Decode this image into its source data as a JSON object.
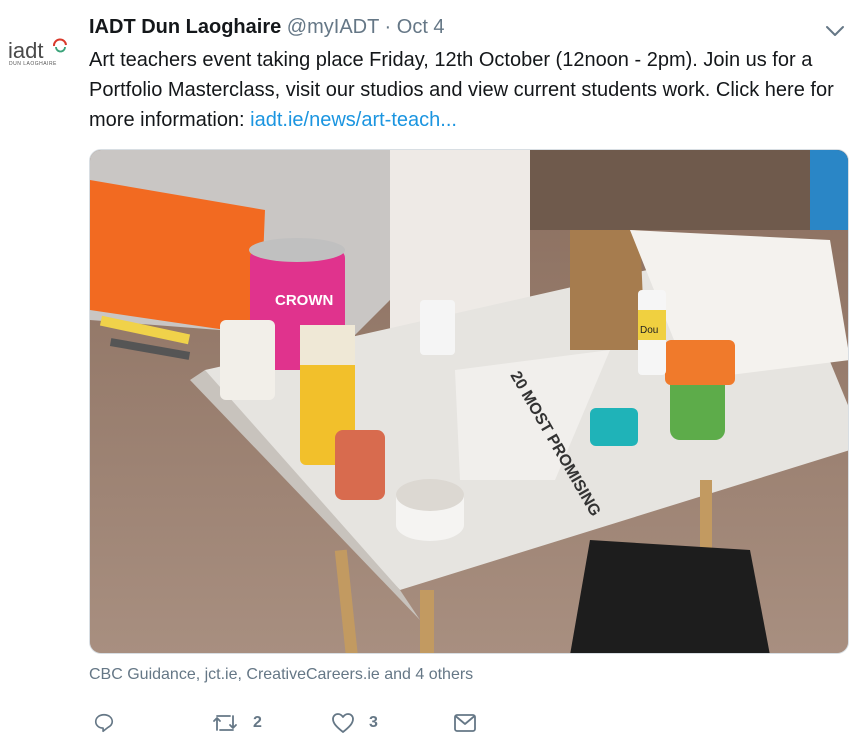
{
  "tweet": {
    "author_name": "IADT Dun Laoghaire",
    "handle": "@myIADT",
    "separator": "·",
    "date": "Oct 4",
    "text_main": "Art teachers event taking place Friday, 12th October (12noon - 2pm). Join us for a Portfolio Masterclass, visit our studios and view current students work. Click here for more information: ",
    "link_text": "iadt.ie/news/art-teach...",
    "tagged_users": "CBC Guidance, jct.ie, CreativeCareers.ie and 4 others",
    "avatar": {
      "logo_text": "iadt",
      "logo_subtext": "DUN LAOGHAIRE"
    },
    "image": {
      "caption_paint_brand": "CROWN",
      "caption_book": "20 MOST PROMISING",
      "caption_bottle": "Dou"
    }
  },
  "actions": {
    "reply": {
      "icon": "reply-icon",
      "count": ""
    },
    "retweet": {
      "icon": "retweet-icon",
      "count": "2"
    },
    "like": {
      "icon": "heart-icon",
      "count": "3"
    },
    "message": {
      "icon": "envelope-icon",
      "count": ""
    }
  },
  "colors": {
    "link": "#1b95e0",
    "secondary_text": "#657786",
    "primary_text": "#14171a"
  }
}
